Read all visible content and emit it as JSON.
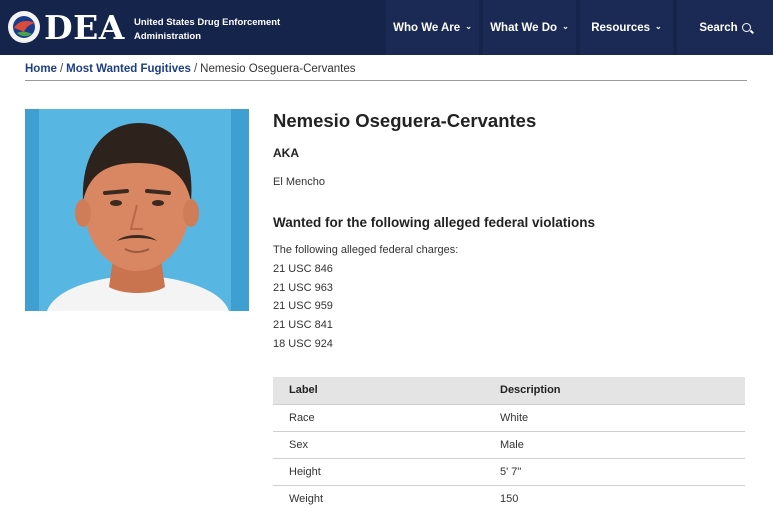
{
  "header": {
    "brand": "DEA",
    "agency_line1": "United States Drug Enforcement",
    "agency_line2": "Administration",
    "nav": [
      "Who We Are",
      "What We Do",
      "Resources",
      "Search"
    ]
  },
  "breadcrumb": {
    "home": "Home",
    "section": "Most Wanted Fugitives",
    "current": "Nemesio Oseguera-Cervantes"
  },
  "fugitive": {
    "name": "Nemesio Oseguera-Cervantes",
    "aka_heading": "AKA",
    "aka": "El Mencho",
    "violations_heading": "Wanted for the following alleged federal violations",
    "charges_intro": "The following alleged federal charges:",
    "charges": [
      "21 USC 846",
      "21 USC 963",
      "21 USC 959",
      "21 USC 841",
      "18 USC 924"
    ]
  },
  "table": {
    "headers": [
      "Label",
      "Description"
    ],
    "rows": [
      [
        "Race",
        "White"
      ],
      [
        "Sex",
        "Male"
      ],
      [
        "Height",
        "5' 7\""
      ],
      [
        "Weight",
        "150"
      ]
    ]
  },
  "colors": {
    "header_bg": "#15244b",
    "link": "#1d3f86",
    "photo_bg": "#58b6e2"
  }
}
